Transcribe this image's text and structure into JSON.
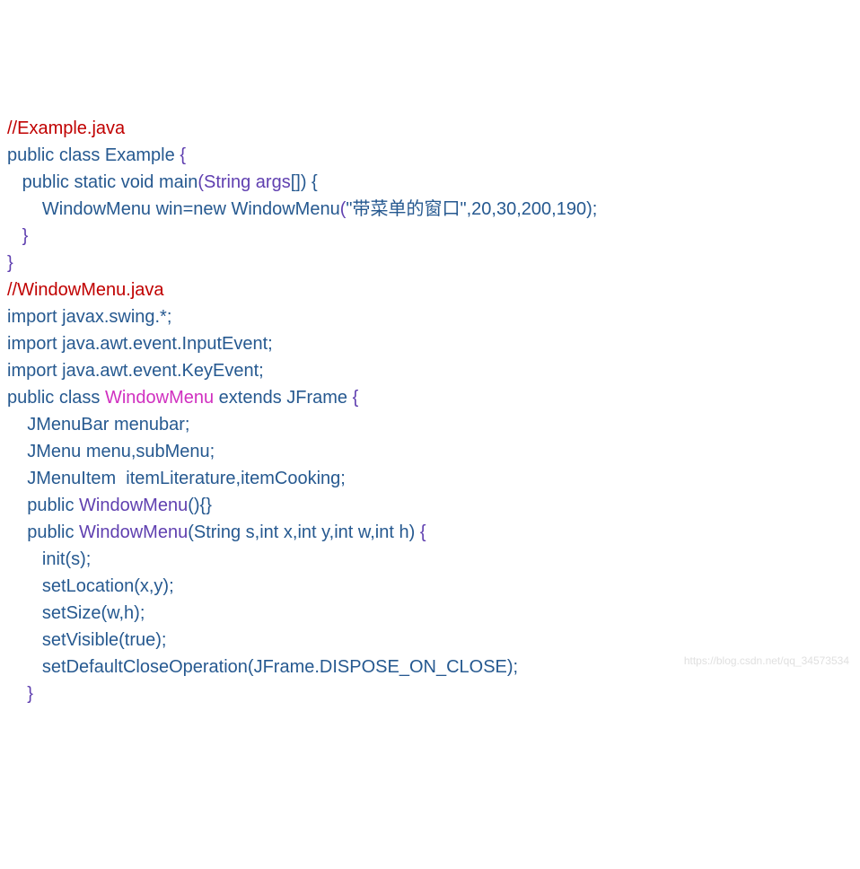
{
  "code": {
    "l1": "//Example.java",
    "l2a": "public class Example ",
    "l2b": "{",
    "l3a": "   public static void main",
    "l3b": "(String args",
    "l3c": "[]) {",
    "l4a": "       WindowMenu win=new WindowMenu",
    "l4b": "(",
    "l4c": "\"带菜单的窗口\"",
    "l4d": ",",
    "l4e": "20",
    "l4f": ",",
    "l4g": "30",
    "l4h": ",",
    "l4i": "200",
    "l4j": ",",
    "l4k": "190",
    "l4l": ");",
    "l5": "   }",
    "l6": "}",
    "l7": "//WindowMenu.java",
    "l8a": "import javax",
    "l8b": ".swing.*;",
    "l9a": "import java",
    "l9b": ".awt.event.InputEvent;",
    "l10a": "import java",
    "l10b": ".awt.event.KeyEvent;",
    "l11a": "public class ",
    "l11b": "WindowMenu",
    "l11c": " extends JFrame ",
    "l11d": "{",
    "l12a": "    JMenuBar ",
    "l12b": "menubar;",
    "l13a": "    JMenu ",
    "l13b": "menu,subMenu;",
    "l14a": "    JMenuItem  ",
    "l14b": "itemLiterature,itemCooking;",
    "l15a": "    public ",
    "l15b": "WindowMenu",
    "l15c": "(){}",
    "l16a": "    public ",
    "l16b": "WindowMenu",
    "l16c": "(String s,int x,int y,int w,int h) ",
    "l16d": "{",
    "l17a": "       init",
    "l17b": "(s);",
    "l18a": "       setLocation",
    "l18b": "(x,y);",
    "l19a": "       setSize",
    "l19b": "(w,h);",
    "l20a": "       setVisible",
    "l20b": "(true);",
    "l21a": "       setDefaultCloseOperation",
    "l21b": "(JFrame.DISPOSE_ON_CLOSE);",
    "l22": "    }"
  },
  "watermark": "https://blog.csdn.net/qq_34573534"
}
